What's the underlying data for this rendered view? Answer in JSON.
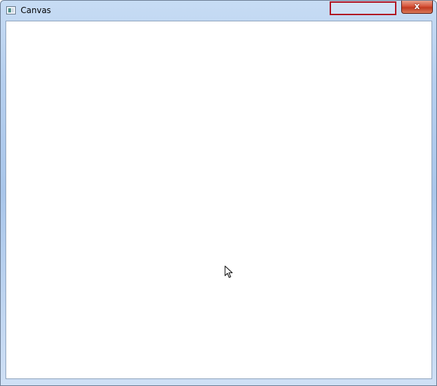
{
  "window": {
    "title": "Canvas",
    "close_glyph": "x",
    "icons": {
      "app": "app-window-icon",
      "close": "close-icon",
      "cursor": "mouse-pointer-icon"
    },
    "colors": {
      "highlight_border": "#b00f1f",
      "close_button": "#c23a20",
      "client_background": "#ffffff"
    }
  }
}
